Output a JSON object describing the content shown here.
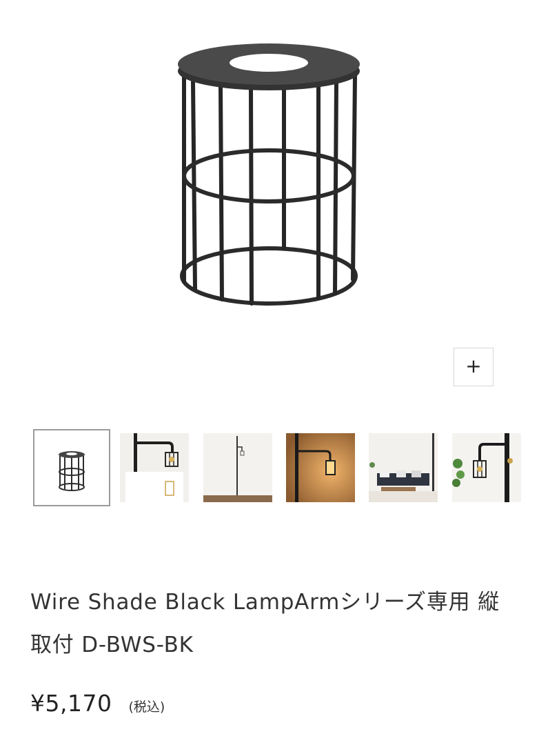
{
  "product": {
    "title": "Wire Shade Black LampArmシリーズ専用 縦取付 D-BWS-BK",
    "price": "¥5,170",
    "tax_note": "(税込)"
  },
  "gallery": {
    "zoom_label": "+",
    "zoom_icon": "plus-icon",
    "selected_index": 0,
    "thumbnails": [
      {
        "name": "wire-shade-black",
        "selected": true
      },
      {
        "name": "lamp-arm-wall-mounted",
        "selected": false
      },
      {
        "name": "floor-pole-lamp-room",
        "selected": false
      },
      {
        "name": "lamp-lit-warm",
        "selected": false
      },
      {
        "name": "living-room-sofa",
        "selected": false
      },
      {
        "name": "lamp-arm-with-plant",
        "selected": false
      }
    ]
  },
  "colors": {
    "text": "#333333",
    "border": "#d6d6d6",
    "selected_border": "#9a9a9a",
    "shade_metal": "#2b2b2b"
  }
}
